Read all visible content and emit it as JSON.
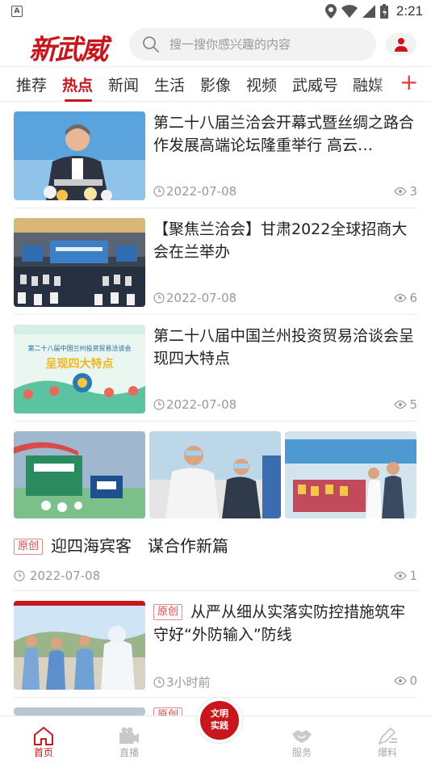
{
  "status_bar": {
    "time": "2:21",
    "notif_letter": "A"
  },
  "header": {
    "logo_text": "新武威",
    "search_placeholder": "搜一搜你感兴趣的内容"
  },
  "tabs": [
    {
      "label": "推荐"
    },
    {
      "label": "热点",
      "active": true
    },
    {
      "label": "新闻"
    },
    {
      "label": "生活"
    },
    {
      "label": "影像"
    },
    {
      "label": "视频"
    },
    {
      "label": "武威号"
    },
    {
      "label": "融媒"
    }
  ],
  "tab_add": "+",
  "articles": [
    {
      "title": "第二十八届兰洽会开幕式暨丝绸之路合作发展高端论坛隆重举行 高云…",
      "date": "2022-07-08",
      "views": "3"
    },
    {
      "title": "【聚焦兰洽会】甘肃2022全球招商大会在兰举办",
      "date": "2022-07-08",
      "views": "6"
    },
    {
      "title": "第二十八届中国兰州投资贸易洽谈会呈现四大特点",
      "date": "2022-07-08",
      "views": "5",
      "thumb_text": "第二十八届中国兰州投资贸易洽谈会",
      "thumb_big": "呈现四大特点"
    },
    {
      "badge": "原创",
      "title": "迎四海宾客　谋合作新篇",
      "date": "2022-07-08",
      "views": "1"
    },
    {
      "badge": "原创",
      "title": "从严从细从实落实防控措施筑牢守好“外防输入”防线",
      "date": "3小时前",
      "views": "0"
    }
  ],
  "partial_badge": "原创",
  "bottom_nav": [
    {
      "label": "首页",
      "active": true
    },
    {
      "label": "直播"
    },
    {
      "label": "服务"
    },
    {
      "label": "爆料"
    }
  ],
  "center_button": {
    "line1": "文明",
    "line2": "实践"
  },
  "colors": {
    "brand": "#c8161d",
    "muted": "#999999"
  }
}
